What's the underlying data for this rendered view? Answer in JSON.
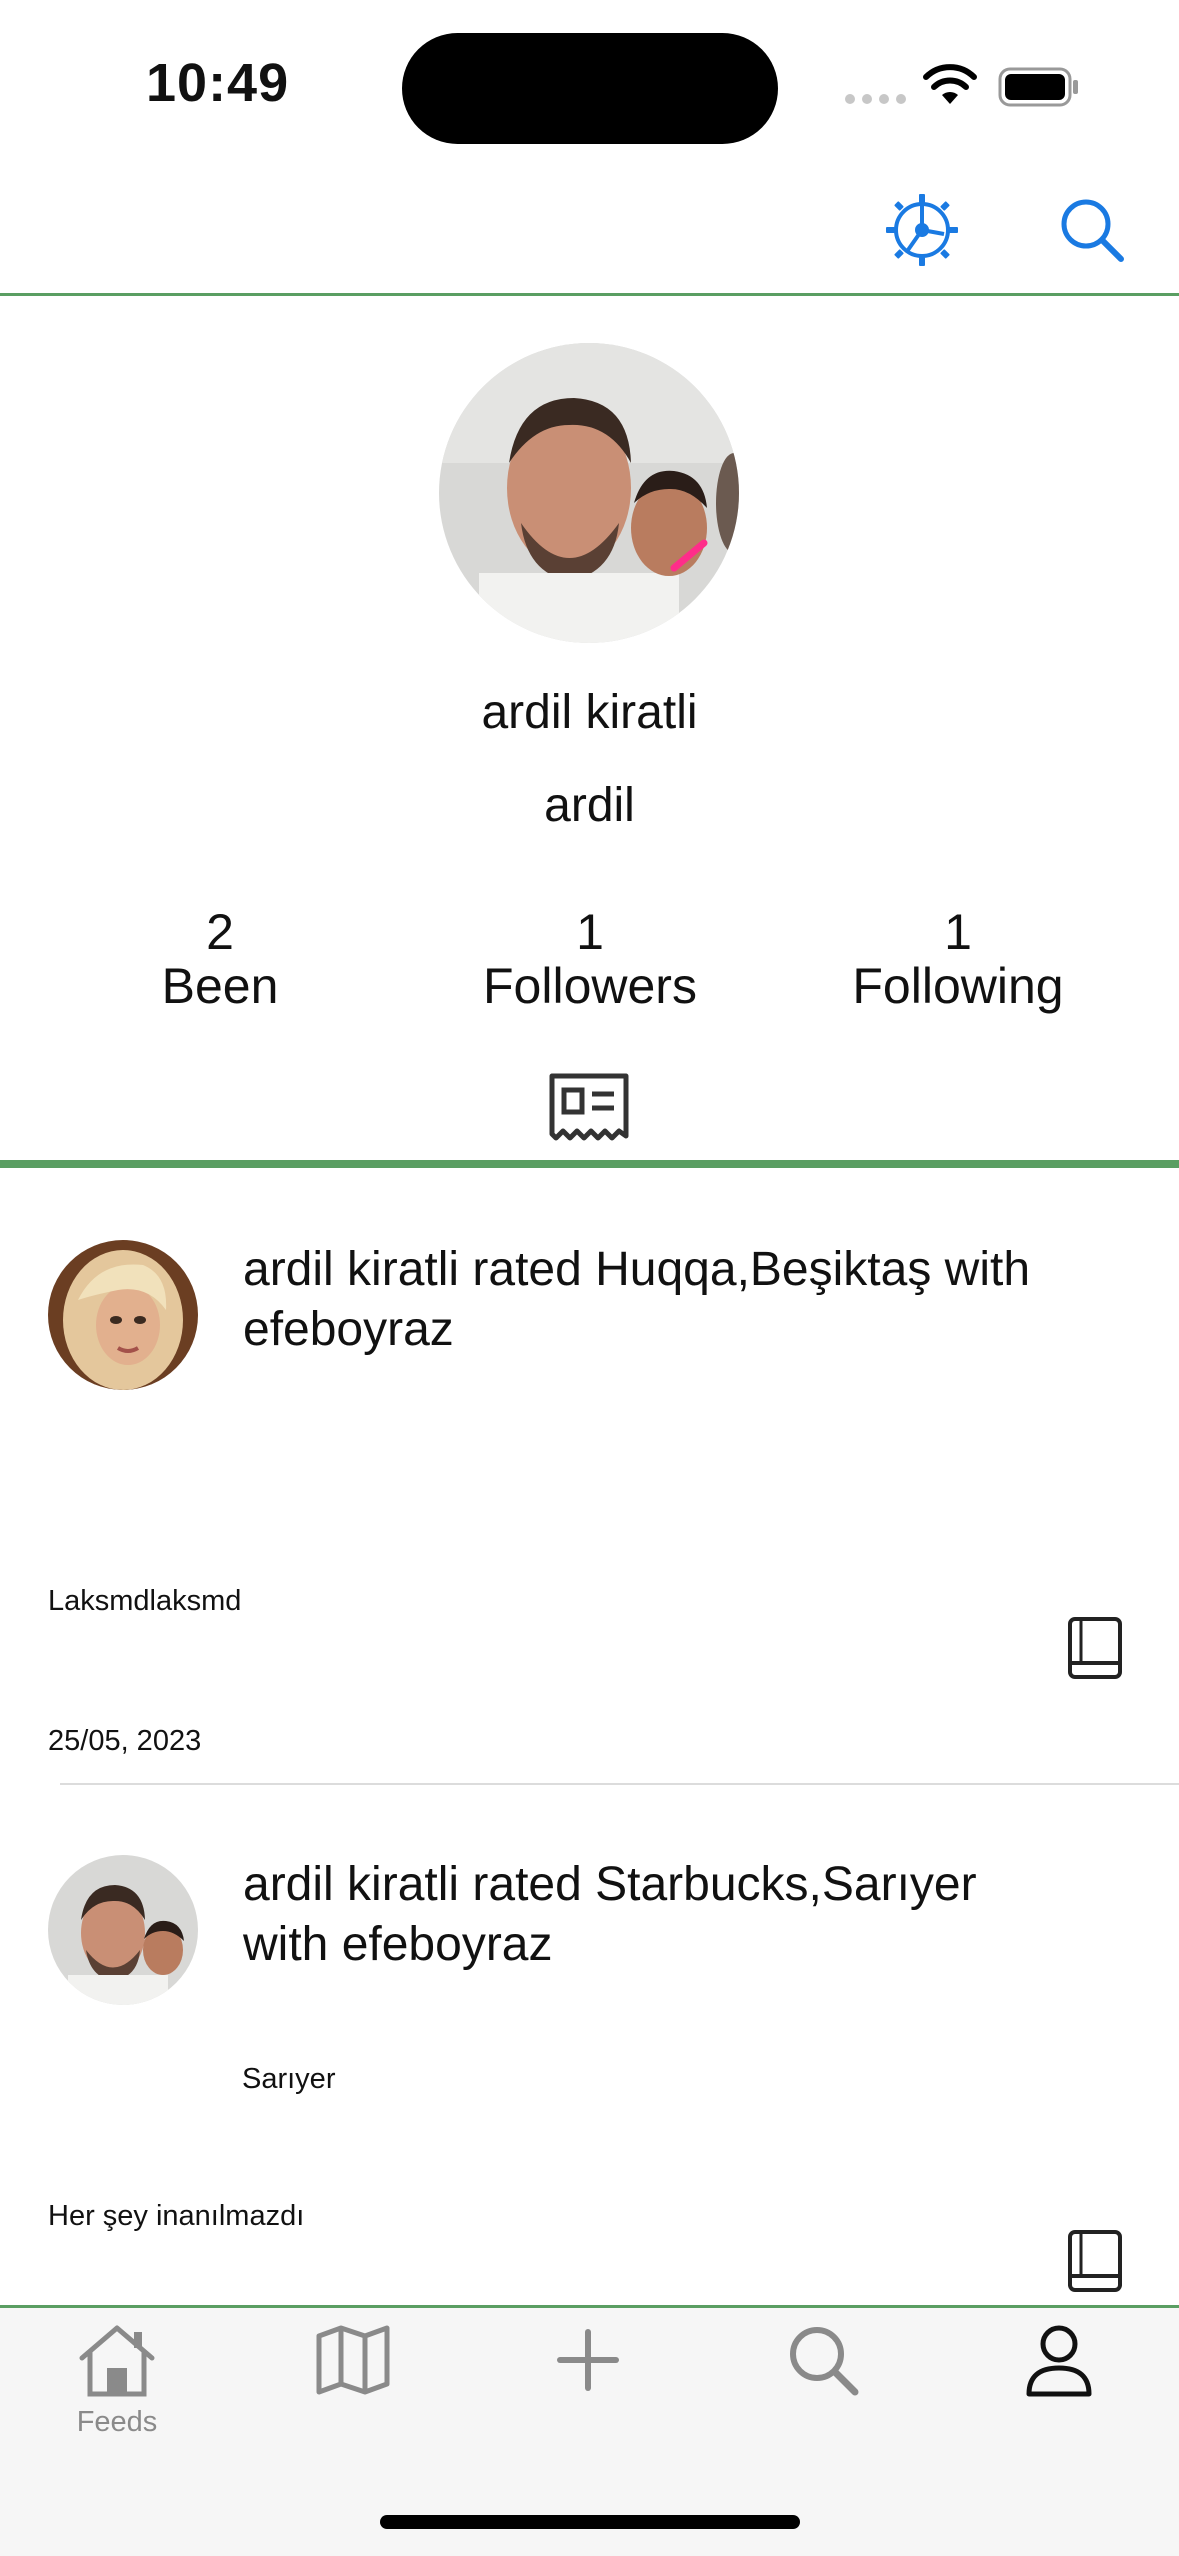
{
  "status_bar": {
    "time": "10:49"
  },
  "profile": {
    "name": "ardil kiratli",
    "username": "ardil",
    "stats": [
      {
        "value": "2",
        "label": "Been"
      },
      {
        "value": "1",
        "label": "Followers"
      },
      {
        "value": "1",
        "label": "Following"
      }
    ]
  },
  "posts": [
    {
      "title": "ardil kiratli  rated Huqqa,Beşiktaş with efeboyraz",
      "comment": "Laksmdlaksmd",
      "date": "25/05, 2023"
    },
    {
      "title": "ardil kiratli  rated Starbucks,Sarıyer with efeboyraz",
      "location": "Sarıyer",
      "comment": "Her şey inanılmazdı"
    }
  ],
  "tabbar": {
    "feeds_label": "Feeds"
  },
  "colors": {
    "accent_blue": "#1a7ae2",
    "divider_green": "#5a9e62",
    "tab_inactive": "#8a8a8a"
  },
  "icons": [
    "settings-icon",
    "search-icon",
    "newspaper-icon",
    "book-icon",
    "home-icon",
    "map-icon",
    "plus-icon",
    "person-icon"
  ]
}
